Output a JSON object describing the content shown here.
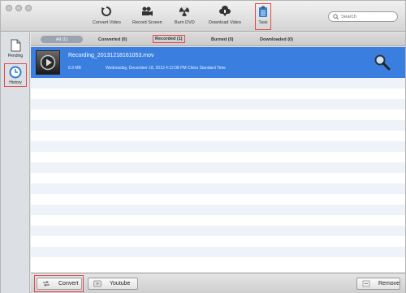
{
  "toolbar": {
    "items": [
      {
        "label": "Convert Video",
        "icon": "convert-video-icon"
      },
      {
        "label": "Record Screen",
        "icon": "record-screen-icon"
      },
      {
        "label": "Burn DVD",
        "icon": "burn-dvd-icon"
      },
      {
        "label": "Download Video",
        "icon": "download-video-icon"
      },
      {
        "label": "Task",
        "icon": "task-icon"
      }
    ],
    "search_placeholder": "Search"
  },
  "sidebar": {
    "items": [
      {
        "label": "Pending",
        "icon": "document-icon"
      },
      {
        "label": "History",
        "icon": "clock-icon"
      }
    ]
  },
  "tabs": [
    {
      "label": "All (1)"
    },
    {
      "label": "Converted (0)"
    },
    {
      "label": "Recorded (1)"
    },
    {
      "label": "Burned (0)"
    },
    {
      "label": "Downloaded (0)"
    }
  ],
  "list": {
    "items": [
      {
        "filename": "Recording_20131218161053.mov",
        "size": "6.9 MB",
        "date": "Wednesday, December 18, 2013 4:12:08 PM China Standard Time"
      }
    ]
  },
  "bottom": {
    "convert_label": "Convert",
    "youtube_label": "Youtube",
    "remove_label": "Remove"
  },
  "colors": {
    "selection": "#3a7fe0",
    "highlight_box": "#e14b4b",
    "stripe": "#eef3fa"
  }
}
